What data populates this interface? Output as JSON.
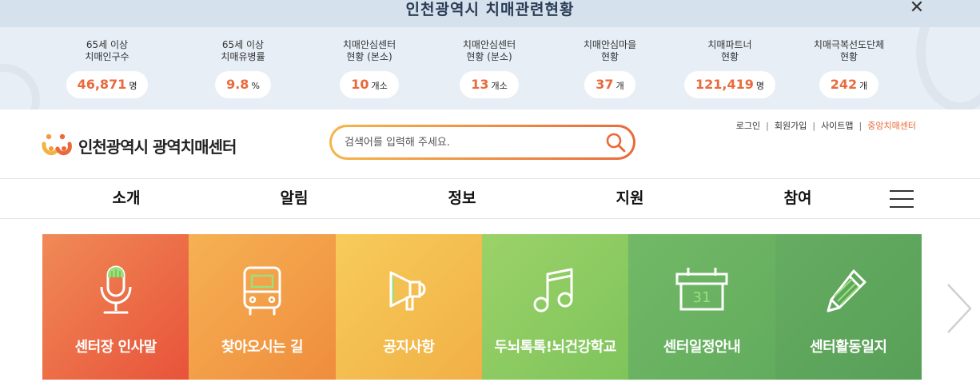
{
  "stats_banner": {
    "title": "인천광역시 치매관련현황",
    "close_symbol": "✕",
    "items": [
      {
        "label": "65세 이상\n치매인구수",
        "value": "46,871",
        "unit": "명"
      },
      {
        "label": "65세 이상\n치매유병률",
        "value": "9.8",
        "unit": "%"
      },
      {
        "label": "치매안심센터\n현황 (본소)",
        "value": "10",
        "unit": "개소"
      },
      {
        "label": "치매안심센터\n현황 (분소)",
        "value": "13",
        "unit": "개소"
      },
      {
        "label": "치매안심마을\n현황",
        "value": "37",
        "unit": "개"
      },
      {
        "label": "치매파트너\n현황",
        "value": "121,419",
        "unit": "명"
      },
      {
        "label": "치매극복선도단체\n현황",
        "value": "242",
        "unit": "개"
      }
    ]
  },
  "header": {
    "logo_text": "인천광역시 광역치매센터",
    "search_placeholder": "검색어를 입력해 주세요.",
    "util_links": [
      "로그인",
      "회원가입",
      "사이트맵",
      "중앙치매센터"
    ]
  },
  "nav": {
    "items": [
      "소개",
      "알림",
      "정보",
      "지원",
      "참여"
    ]
  },
  "quick_menu": {
    "tiles": [
      {
        "label": "센터장 인사말",
        "icon": "microphone-icon"
      },
      {
        "label": "찾아오시는 길",
        "icon": "bus-icon"
      },
      {
        "label": "공지사항",
        "icon": "megaphone-icon"
      },
      {
        "label": "두뇌톡톡!뇌건강학교",
        "icon": "music-note-icon"
      },
      {
        "label": "센터일정안내",
        "icon": "calendar-icon"
      },
      {
        "label": "센터활동일지",
        "icon": "pencil-icon"
      }
    ],
    "calendar_day": "31"
  },
  "colors": {
    "accent": "#ea6a3b",
    "banner_bg": "#e7eef6",
    "tile_1": "#ec6a45",
    "tile_2": "#f29b45",
    "tile_3": "#f4c04e",
    "tile_4": "#8ccb62",
    "tile_5": "#6cb565",
    "tile_6": "#5fa95f"
  }
}
